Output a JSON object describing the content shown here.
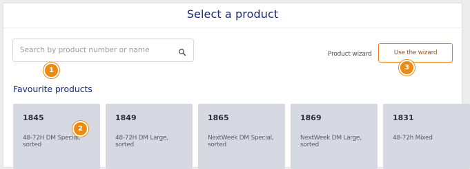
{
  "title": "Select a product",
  "search": {
    "placeholder": "Search by product number or name",
    "icon": "search-icon"
  },
  "wizard": {
    "label": "Product wizard",
    "button_label": "Use the wizard"
  },
  "favourites": {
    "title": "Favourite products",
    "cards": [
      {
        "number": "1845",
        "name": "48-72H DM Special, sorted"
      },
      {
        "number": "1849",
        "name": "48-72H DM Large, sorted"
      },
      {
        "number": "1865",
        "name": "NextWeek DM Special, sorted"
      },
      {
        "number": "1869",
        "name": "NextWeek DM Large, sorted"
      },
      {
        "number": "1831",
        "name": "48-72h Mixed"
      }
    ]
  },
  "badges": [
    "1",
    "2",
    "3"
  ],
  "colors": {
    "accent_orange": "#ed8a12",
    "title_blue": "#14267a",
    "card_bg": "#d6d9e2"
  }
}
